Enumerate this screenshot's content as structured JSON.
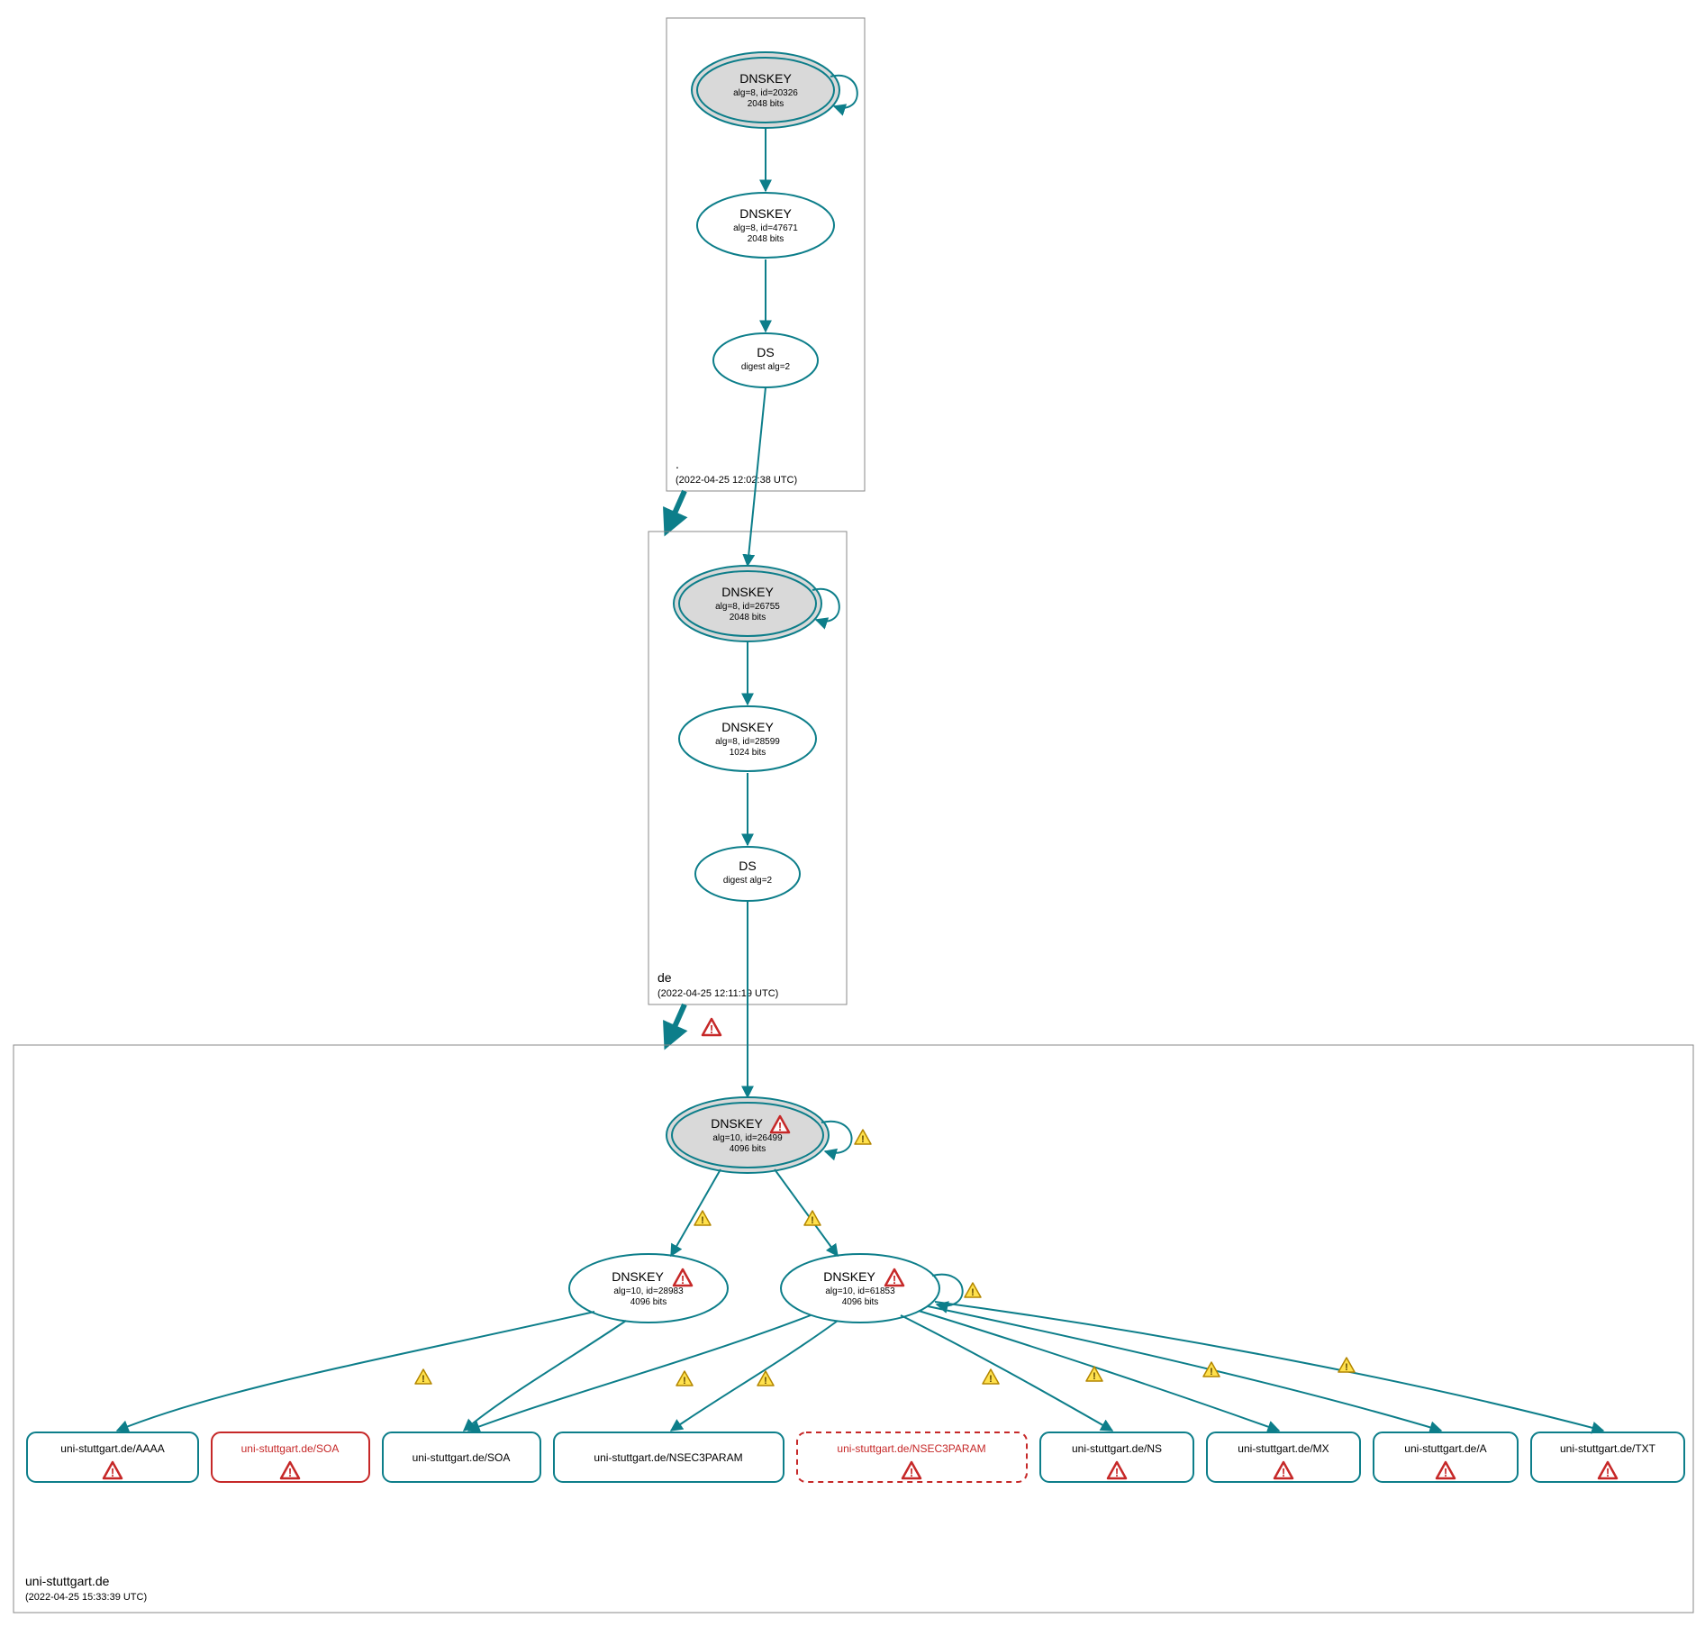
{
  "zones": {
    "root": {
      "name": ".",
      "timestamp": "(2022-04-25 12:02:38 UTC)"
    },
    "de": {
      "name": "de",
      "timestamp": "(2022-04-25 12:11:19 UTC)"
    },
    "leaf": {
      "name": "uni-stuttgart.de",
      "timestamp": "(2022-04-25 15:33:39 UTC)"
    }
  },
  "nodes": {
    "root_ksk": {
      "title": "DNSKEY",
      "line1": "alg=8, id=20326",
      "line2": "2048 bits"
    },
    "root_zsk": {
      "title": "DNSKEY",
      "line1": "alg=8, id=47671",
      "line2": "2048 bits"
    },
    "root_ds": {
      "title": "DS",
      "line1": "digest alg=2",
      "line2": ""
    },
    "de_ksk": {
      "title": "DNSKEY",
      "line1": "alg=8, id=26755",
      "line2": "2048 bits"
    },
    "de_zsk": {
      "title": "DNSKEY",
      "line1": "alg=8, id=28599",
      "line2": "1024 bits"
    },
    "de_ds": {
      "title": "DS",
      "line1": "digest alg=2",
      "line2": ""
    },
    "leaf_ksk": {
      "title": "DNSKEY",
      "line1": "alg=10, id=26499",
      "line2": "4096 bits"
    },
    "leaf_zsk1": {
      "title": "DNSKEY",
      "line1": "alg=10, id=28983",
      "line2": "4096 bits"
    },
    "leaf_zsk2": {
      "title": "DNSKEY",
      "line1": "alg=10, id=61853",
      "line2": "4096 bits"
    }
  },
  "rrsets": {
    "aaaa": {
      "label": "uni-stuttgart.de/AAAA"
    },
    "soa_r": {
      "label": "uni-stuttgart.de/SOA"
    },
    "soa_t": {
      "label": "uni-stuttgart.de/SOA"
    },
    "n3p_t": {
      "label": "uni-stuttgart.de/NSEC3PARAM"
    },
    "n3p_d": {
      "label": "uni-stuttgart.de/NSEC3PARAM"
    },
    "ns": {
      "label": "uni-stuttgart.de/NS"
    },
    "mx": {
      "label": "uni-stuttgart.de/MX"
    },
    "a": {
      "label": "uni-stuttgart.de/A"
    },
    "txt": {
      "label": "uni-stuttgart.de/TXT"
    }
  },
  "icons": {
    "warn_yellow": "⚠",
    "warn_red": "⚠"
  },
  "colors": {
    "teal": "#0d7e8a",
    "sep_fill": "#d9d9d9",
    "error": "#c62828",
    "warn": "#f7c600"
  }
}
